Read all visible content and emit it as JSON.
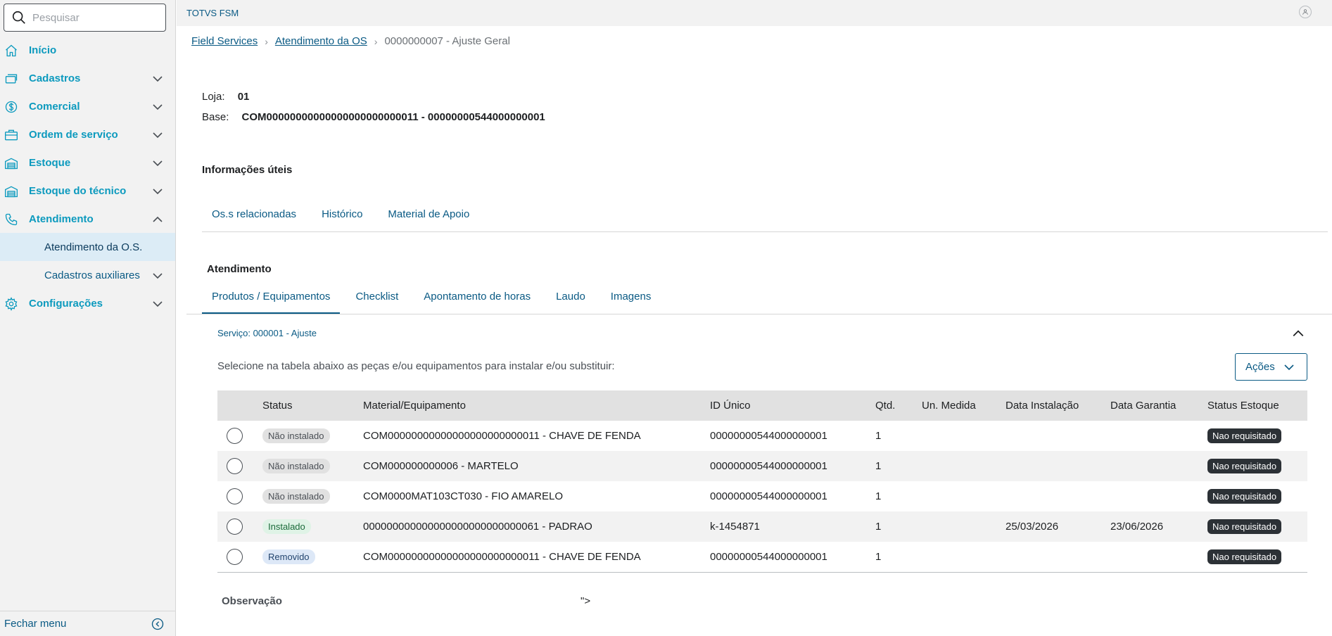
{
  "search": {
    "placeholder": "Pesquisar"
  },
  "sidebar": {
    "items": [
      {
        "label": "Início"
      },
      {
        "label": "Cadastros"
      },
      {
        "label": "Comercial"
      },
      {
        "label": "Ordem de serviço"
      },
      {
        "label": "Estoque"
      },
      {
        "label": "Estoque do técnico"
      },
      {
        "label": "Atendimento"
      }
    ],
    "sub_items": [
      {
        "label": "Atendimento da O.S."
      },
      {
        "label": "Cadastros auxiliares"
      }
    ],
    "config": {
      "label": "Configurações"
    },
    "close_menu": "Fechar menu"
  },
  "topbar": {
    "brand": "TOTVS FSM"
  },
  "breadcrumb": {
    "item1": "Field Services",
    "item2": "Atendimento da OS",
    "current": "0000000007 - Ajuste Geral"
  },
  "info": {
    "loja_label": "Loja:",
    "loja_value": "01",
    "base_label": "Base:",
    "base_value": "COM00000000000000000000000011 - 00000000544000000001"
  },
  "useful": {
    "title": "Informações úteis",
    "tabs": [
      "Os.s relacionadas",
      "Histórico",
      "Material de Apoio"
    ]
  },
  "attendance": {
    "title": "Atendimento",
    "tabs": [
      "Produtos / Equipamentos",
      "Checklist",
      "Apontamento de horas",
      "Laudo",
      "Imagens"
    ]
  },
  "service": {
    "title": "Serviço: 000001 - Ajuste",
    "description": "Selecione na tabela abaixo as peças e/ou equipamentos para instalar e/ou substituir:",
    "actions_label": "Ações"
  },
  "table": {
    "headers": [
      "Status",
      "Material/Equipamento",
      "ID Único",
      "Qtd.",
      "Un. Medida",
      "Data Instalação",
      "Data Garantia",
      "Status Estoque"
    ],
    "rows": [
      {
        "status": "Não instalado",
        "material": "COM00000000000000000000000011 - CHAVE DE FENDA",
        "id": "00000000544000000001",
        "qtd": "1",
        "un": "",
        "data_inst": "",
        "data_gar": "",
        "estoque": "Nao requisitado"
      },
      {
        "status": "Não instalado",
        "material": "COM000000000006 - MARTELO",
        "id": "00000000544000000001",
        "qtd": "1",
        "un": "",
        "data_inst": "",
        "data_gar": "",
        "estoque": "Nao requisitado"
      },
      {
        "status": "Não instalado",
        "material": "COM0000MAT103CT030 - FIO AMARELO",
        "id": "00000000544000000001",
        "qtd": "1",
        "un": "",
        "data_inst": "",
        "data_gar": "",
        "estoque": "Nao requisitado"
      },
      {
        "status": "Instalado",
        "material": "000000000000000000000000000061 - PADRAO",
        "id": "k-1454871",
        "qtd": "1",
        "un": "",
        "data_inst": "25/03/2026",
        "data_gar": "23/06/2026",
        "estoque": "Nao requisitado"
      },
      {
        "status": "Removido",
        "material": "COM00000000000000000000000011 - CHAVE DE FENDA",
        "id": "00000000544000000001",
        "qtd": "1",
        "un": "",
        "data_inst": "",
        "data_gar": "",
        "estoque": "Nao requisitado"
      }
    ]
  },
  "observation": {
    "label": "Observação",
    "stray_text": "\">"
  }
}
